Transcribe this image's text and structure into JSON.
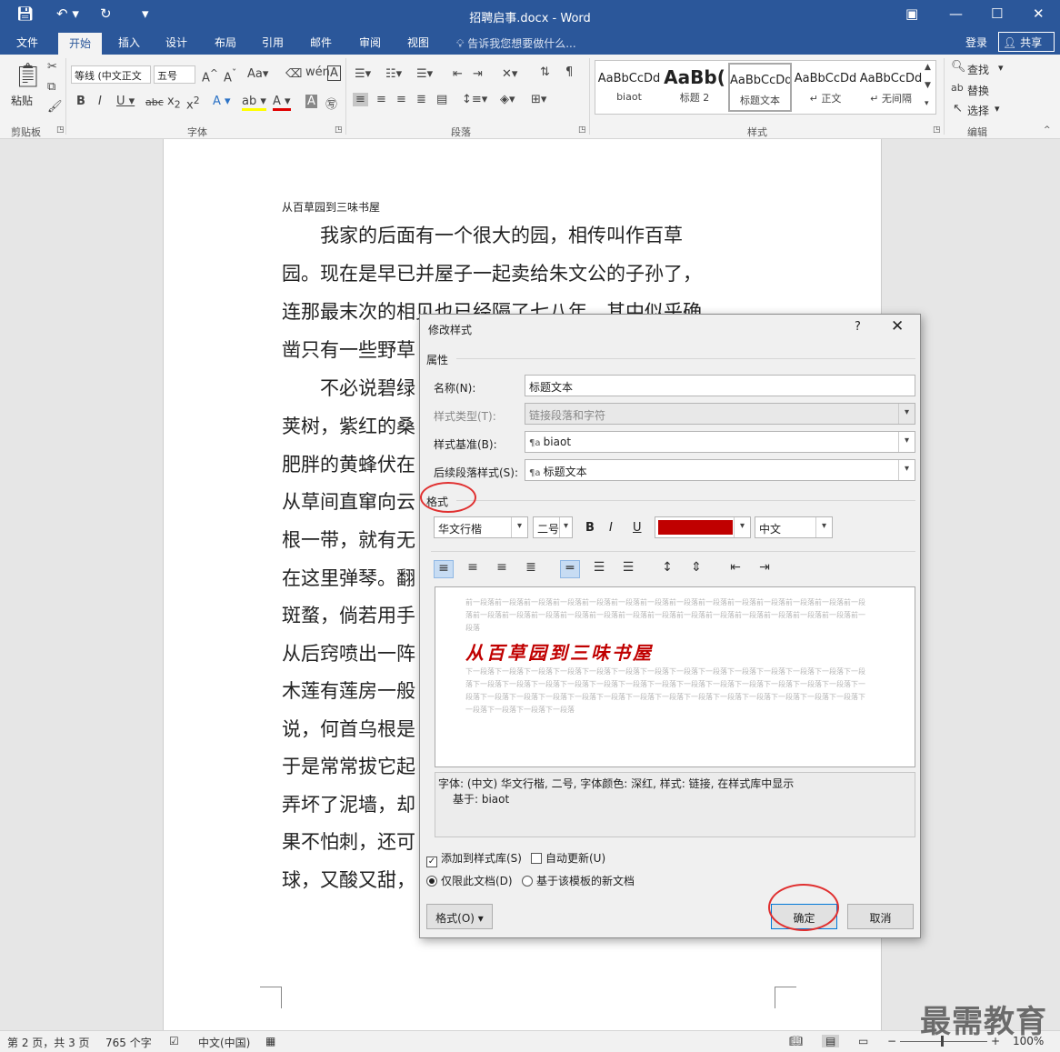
{
  "window": {
    "title": "招聘启事.docx - Word"
  },
  "tabs": [
    "文件",
    "开始",
    "插入",
    "设计",
    "布局",
    "引用",
    "邮件",
    "审阅",
    "视图"
  ],
  "tell_me": "告诉我您想要做什么...",
  "account": {
    "login": "登录",
    "share": "共享"
  },
  "ribbon": {
    "paste_label": "粘贴",
    "font_name": "等线 (中文正文",
    "font_size": "五号",
    "group_labels": [
      "剪贴板",
      "字体",
      "段落",
      "样式",
      "编辑"
    ],
    "styles": [
      {
        "preview": "AaBbCcDd",
        "name": "biaot"
      },
      {
        "preview": "AaBb(",
        "name": "标题 2"
      },
      {
        "preview": "AaBbCcDd",
        "name": "标题文本"
      },
      {
        "preview": "AaBbCcDd",
        "name": "↵ 正文"
      },
      {
        "preview": "AaBbCcDd",
        "name": "↵ 无间隔"
      }
    ],
    "edit": {
      "find": "查找",
      "replace": "替换",
      "select": "选择"
    }
  },
  "document": {
    "header_line": "从百草园到三味书屋",
    "lines": [
      "　　我家的后面有一个很大的园，相传叫作百草",
      "园。现在是早已并屋子一起卖给朱文公的子孙了，",
      "连那最末次的相见也已经隔了七八年，其中似乎确",
      "凿只有一些野草",
      "　　不必说碧绿",
      "荚树，紫红的桑",
      "肥胖的黄蜂伏在",
      "从草间直窜向云",
      "根一带，就有无",
      "在这里弹琴。翻",
      "斑蝥，倘若用手",
      "从后窍喷出一阵",
      "木莲有莲房一般",
      "说，何首乌根是",
      "于是常常拔它起",
      "弄坏了泥墙，却",
      "果不怕刺，还可",
      "球，又酸又甜，"
    ]
  },
  "dialog": {
    "title": "修改样式",
    "help": "?",
    "close": "✕",
    "section_props": "属性",
    "name_label": "名称(N):",
    "name_value": "标题文本",
    "type_label": "样式类型(T):",
    "type_value": "链接段落和字符",
    "based_label": "样式基准(B):",
    "based_value": "biaot",
    "next_label": "后续段落样式(S):",
    "next_value": "标题文本",
    "section_format": "格式",
    "font_value": "华文行楷",
    "size_value": "二号",
    "bold": "B",
    "italic": "I",
    "underline": "U",
    "font_color": "#c00000",
    "lang_value": "中文",
    "preview_prev": "前一段落前一段落前一段落前一段落前一段落前一段落前一段落前一段落前一段落前一段落前一段落前一段落前一段落前一段落前一段落前一段落前一段落前一段落前一段落前一段落前一段落前一段落前一段落前一段落前一段落前一段落前一段落前一段落",
    "preview_text": "从百草园到三味书屋",
    "preview_next": "下一段落下一段落下一段落下一段落下一段落下一段落下一段落下一段落下一段落下一段落下一段落下一段落下一段落下一段落下一段落下一段落下一段落下一段落下一段落下一段落下一段落下一段落下一段落下一段落下一段落下一段落下一段落下一段落下一段落下一段落下一段落下一段落下一段落下一段落下一段落下一段落下一段落下一段落下一段落下一段落下一段落下一段落下一段落下一段落下一段落",
    "desc_line1": "字体: (中文) 华文行楷, 二号, 字体颜色: 深红, 样式: 链接, 在样式库中显示",
    "desc_line2": "基于: biaot",
    "add_to_gallery": "添加到样式库(S)",
    "auto_update": "自动更新(U)",
    "only_doc": "仅限此文档(D)",
    "new_docs": "基于该模板的新文档",
    "format_btn": "格式(O) ▾",
    "ok": "确定",
    "cancel": "取消"
  },
  "status": {
    "page": "第 2 页，共 3 页",
    "words": "765 个字",
    "lang": "中文(中国)",
    "zoom": "100%"
  },
  "watermark": "最需教育"
}
